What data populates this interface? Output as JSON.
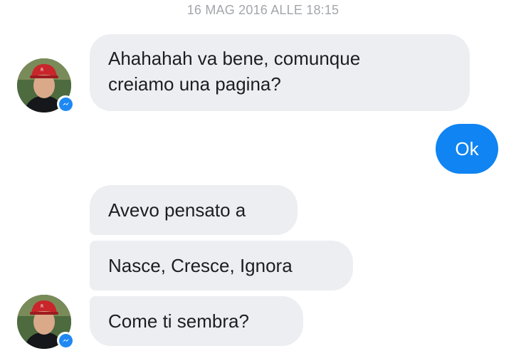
{
  "thread": {
    "timestamp": "16 MAG 2016 ALLE 18:15",
    "messages": [
      {
        "direction": "incoming",
        "line1": "Ahahahah va bene, comunque",
        "line2": "creiamo una pagina?"
      },
      {
        "direction": "outgoing",
        "text": "Ok"
      },
      {
        "direction": "incoming",
        "text": "Avevo pensato a"
      },
      {
        "direction": "incoming",
        "text": "Nasce, Cresce, Ignora"
      },
      {
        "direction": "incoming",
        "text": "Come ti sembra?"
      }
    ]
  },
  "icons": {
    "avatar": "contact-avatar",
    "badge": "messenger-icon"
  },
  "colors": {
    "incoming_bubble": "#eceef1",
    "outgoing_bubble": "#0f84f2",
    "timestamp": "#a3a6ab",
    "messenger_badge": "#1e88f3"
  }
}
